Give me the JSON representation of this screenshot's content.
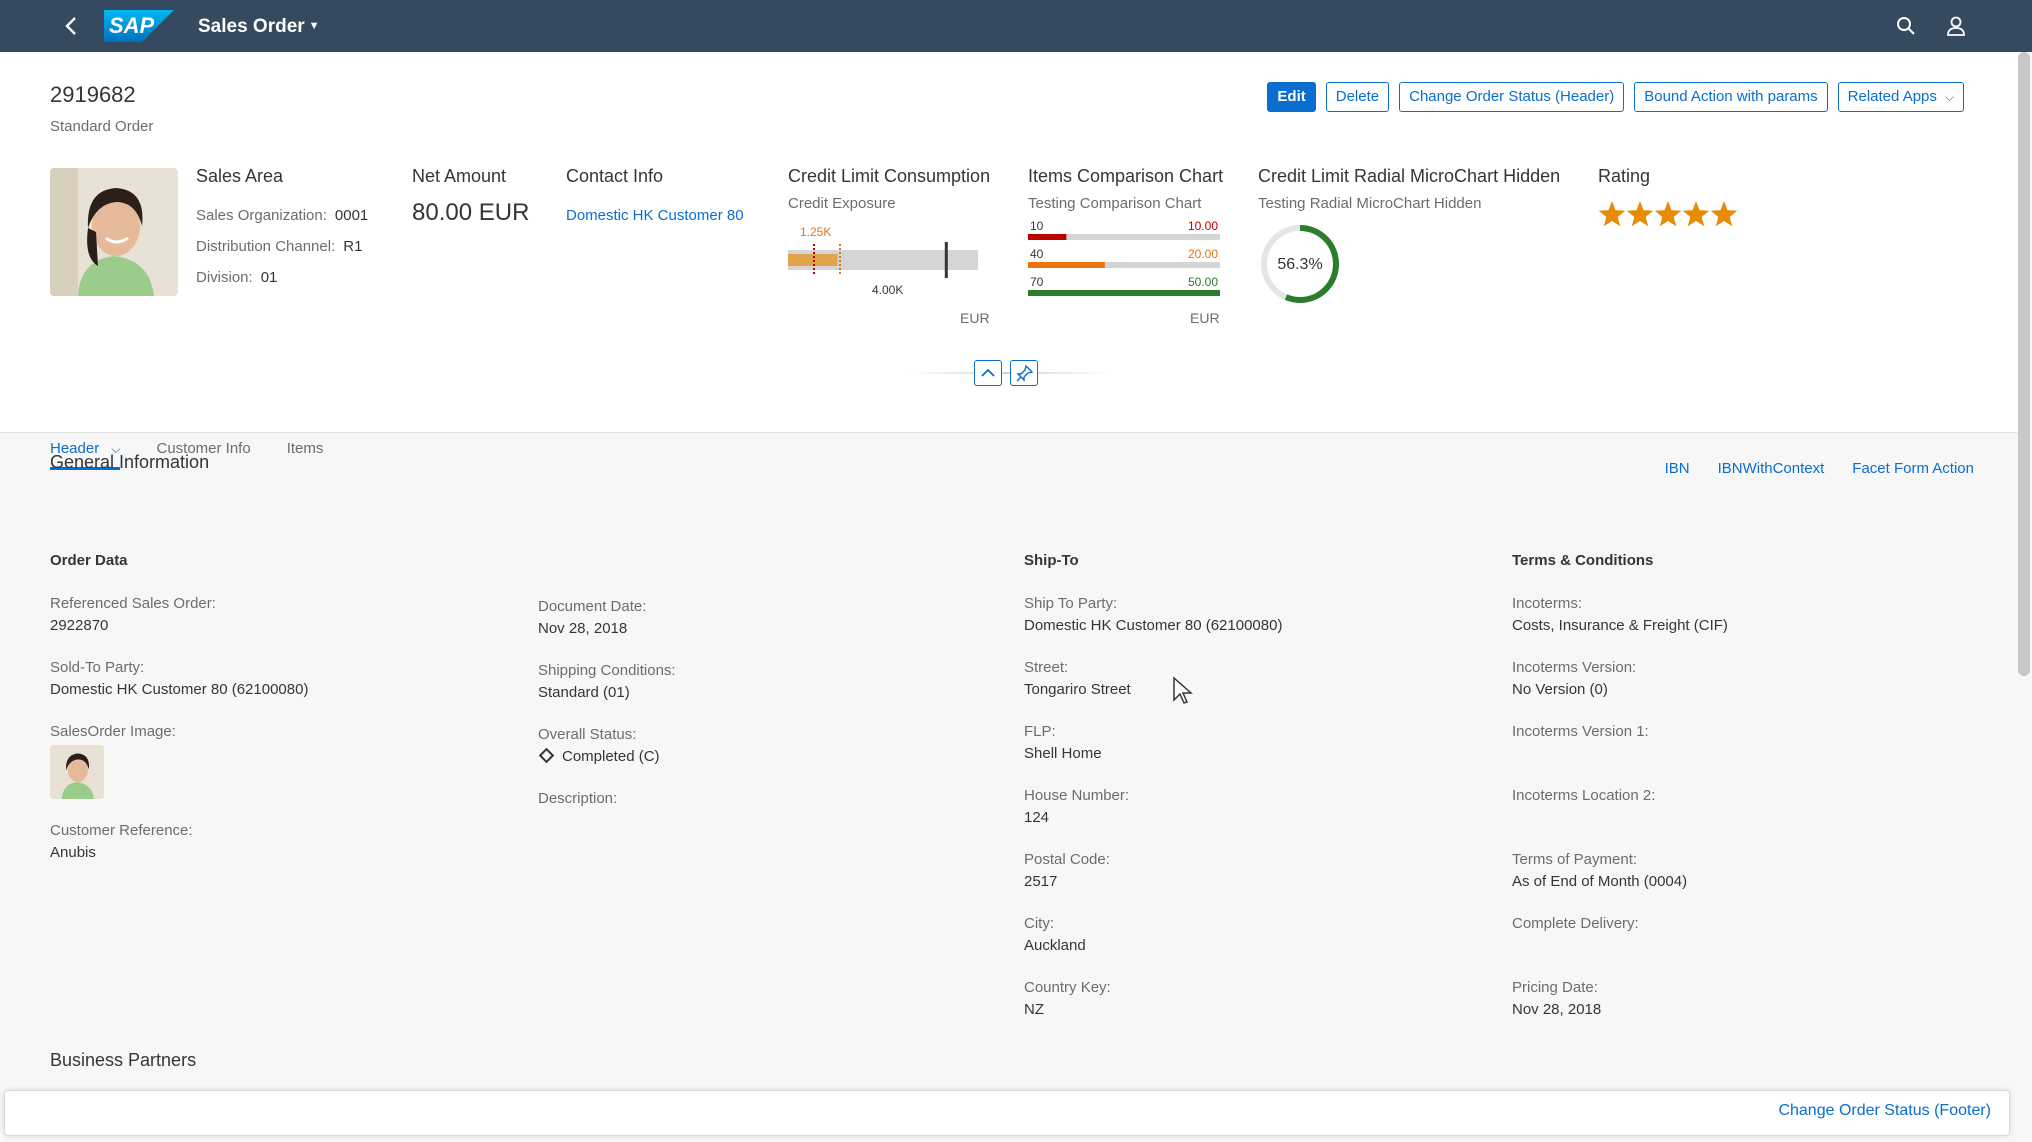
{
  "shell": {
    "app_title": "Sales Order",
    "logo_text": "SAP"
  },
  "header": {
    "title": "2919682",
    "subtitle": "Standard Order",
    "actions": [
      {
        "label": "Edit"
      },
      {
        "label": "Delete"
      },
      {
        "label": "Change Order Status (Header)"
      },
      {
        "label": "Bound Action with params"
      },
      {
        "label": "Related Apps"
      }
    ],
    "sales_area": {
      "title": "Sales Area",
      "fields": [
        {
          "label": "Sales Organization:",
          "value": "0001"
        },
        {
          "label": "Distribution Channel:",
          "value": "R1"
        },
        {
          "label": "Division:",
          "value": "01"
        }
      ]
    },
    "net_amount": {
      "title": "Net Amount",
      "value": "80.00 EUR"
    },
    "contact_info": {
      "title": "Contact Info",
      "link": "Domestic HK Customer 80"
    },
    "credit_limit": {
      "title": "Credit Limit Consumption",
      "subtitle": "Credit Exposure",
      "value_label": "1.25K",
      "target_label": "4.00K",
      "value": 1250,
      "target": 4000,
      "unit": "EUR"
    },
    "items_chart": {
      "title": "Items Comparison Chart",
      "subtitle": "Testing Comparison Chart",
      "unit": "EUR",
      "rows": [
        {
          "label": "10",
          "value_text": "10.00",
          "value": 10,
          "color": "#bb0000"
        },
        {
          "label": "40",
          "value_text": "20.00",
          "value": 20,
          "color": "#e9730c"
        },
        {
          "label": "70",
          "value_text": "50.00",
          "value": 50,
          "color": "#2b7d2b"
        }
      ]
    },
    "radial": {
      "title": "Credit Limit Radial MicroChart Hidden",
      "subtitle": "Testing Radial MicroChart Hidden",
      "percent_text": "56.3%",
      "percent": 56.3,
      "color": "#2b7d2b"
    },
    "rating": {
      "title": "Rating",
      "value": 5,
      "max": 5,
      "color": "#e78c07"
    }
  },
  "tabs": [
    {
      "label": "Header",
      "selected": true
    },
    {
      "label": "Customer Info"
    },
    {
      "label": "Items"
    }
  ],
  "general": {
    "title": "General Information",
    "links": [
      "IBN",
      "IBNWithContext",
      "Facet Form Action"
    ],
    "order_data": {
      "title": "Order Data",
      "fields": [
        {
          "label": "Referenced Sales Order:",
          "value": "2922870",
          "link": true
        },
        {
          "label": "Sold-To Party:",
          "value": "Domestic HK Customer 80 (62100080)",
          "link": true
        },
        {
          "label": "SalesOrder Image:",
          "value": "",
          "image": true
        },
        {
          "label": "Customer Reference:",
          "value": "Anubis"
        }
      ]
    },
    "order_data_2": {
      "fields": [
        {
          "label": "Document Date:",
          "value": "Nov 28, 2018"
        },
        {
          "label": "Shipping Conditions:",
          "value": "Standard (01)"
        },
        {
          "label": "Overall Status:",
          "value": "Completed (C)",
          "status": true
        },
        {
          "label": "Description:",
          "value": ""
        }
      ]
    },
    "ship_to": {
      "title": "Ship-To",
      "fields": [
        {
          "label": "Ship To Party:",
          "value": "Domestic HK Customer 80 (62100080)",
          "link": true
        },
        {
          "label": "Street:",
          "value": "Tongariro Street"
        },
        {
          "label": "FLP:",
          "value": "Shell Home",
          "link": true
        },
        {
          "label": "House Number:",
          "value": "124"
        },
        {
          "label": "Postal Code:",
          "value": "2517"
        },
        {
          "label": "City:",
          "value": "Auckland"
        },
        {
          "label": "Country Key:",
          "value": "NZ"
        }
      ]
    },
    "terms": {
      "title": "Terms & Conditions",
      "fields": [
        {
          "label": "Incoterms:",
          "value": "Costs, Insurance & Freight (CIF)"
        },
        {
          "label": "Incoterms Version:",
          "value": "No Version (0)"
        },
        {
          "label": "Incoterms Version 1:",
          "value": ""
        },
        {
          "label": "Incoterms Location 2:",
          "value": ""
        },
        {
          "label": "Terms of Payment:",
          "value": "As of End of Month (0004)"
        },
        {
          "label": "Complete Delivery:",
          "value": ""
        },
        {
          "label": "Pricing Date:",
          "value": "Nov 28, 2018"
        }
      ]
    }
  },
  "business_partners": {
    "title": "Business Partners"
  },
  "footer": {
    "action_label": "Change Order Status (Footer)"
  }
}
